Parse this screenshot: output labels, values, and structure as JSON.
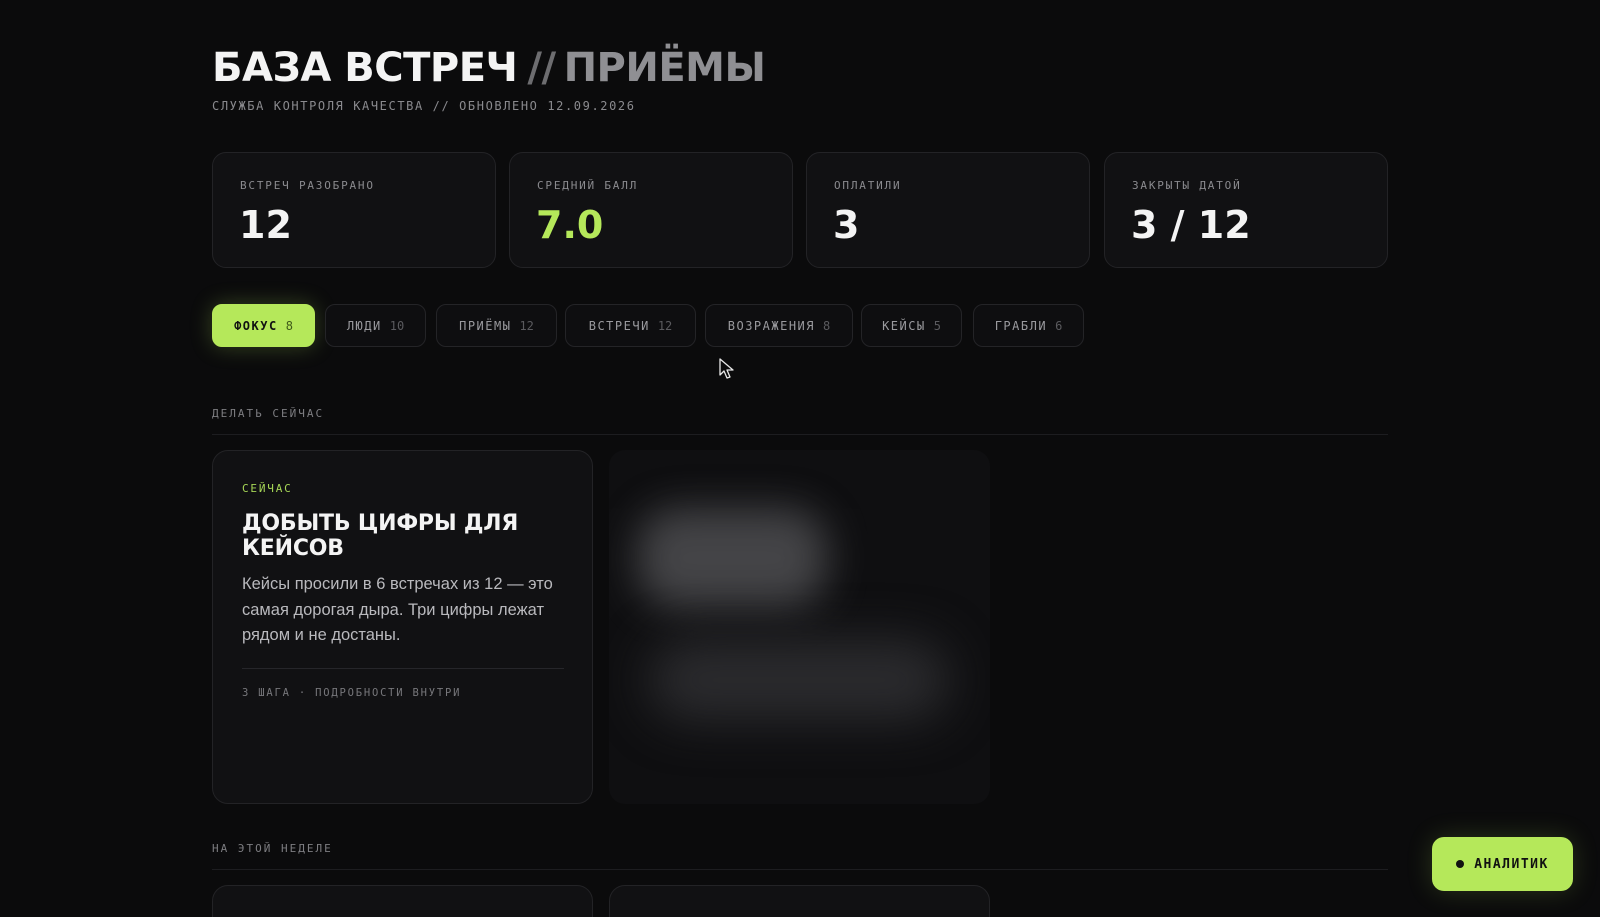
{
  "header": {
    "title_main": "БАЗА ВСТРЕЧ",
    "title_sep": "//",
    "title_sub": "ПРИЁМЫ",
    "subtitle": "СЛУЖБА КОНТРОЛЯ КАЧЕСТВА // ОБНОВЛЕНО 12.09.2026"
  },
  "stats": [
    {
      "label": "ВСТРЕЧ РАЗОБРАНО",
      "value": "12"
    },
    {
      "label": "СРЕДНИЙ БАЛЛ",
      "value": "7.0"
    },
    {
      "label": "ОПЛАТИЛИ",
      "value": "3"
    },
    {
      "label": "ЗАКРЫТЫ ДАТОЙ",
      "value": "3 / 12"
    }
  ],
  "tabs": [
    {
      "label": "ФОКУС",
      "count": "8"
    },
    {
      "label": "ЛЮДИ",
      "count": "10"
    },
    {
      "label": "ПРИЁМЫ",
      "count": "12"
    },
    {
      "label": "ВСТРЕЧИ",
      "count": "12"
    },
    {
      "label": "ВОЗРАЖЕНИЯ",
      "count": "8"
    },
    {
      "label": "КЕЙСЫ",
      "count": "5"
    },
    {
      "label": "ГРАБЛИ",
      "count": "6"
    }
  ],
  "active_tab": "ФОКУС",
  "sections": {
    "now_label": "ДЕЛАТЬ СЕЙЧАС",
    "week_label": "НА ЭТОЙ НЕДЕЛЕ"
  },
  "focus_card": {
    "kicker": "СЕЙЧАС",
    "heading": "ДОБЫТЬ ЦИФРЫ ДЛЯ КЕЙСОВ",
    "body": "Кейсы просили в 6 встречах из 12 — это самая дорогая дыра. Три цифры лежат рядом и не достаны.",
    "footer": "3 ШАГА · ПОДРОБНОСТИ ВНУТРИ"
  },
  "analyst_button": {
    "label": "АНАЛИТИК"
  },
  "colors": {
    "accent": "#b5e85a",
    "background": "#0b0b0c",
    "card": "#111113"
  }
}
